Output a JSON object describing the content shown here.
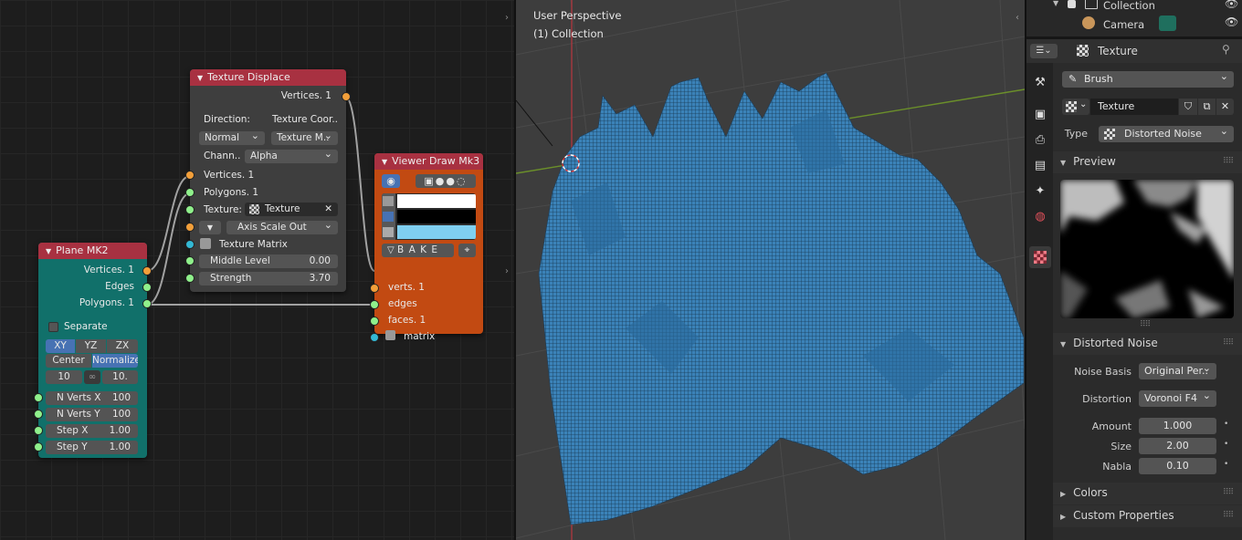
{
  "texture_displace": {
    "title": "Texture Displace",
    "out_vertices": "Vertices. 1",
    "direction_label": "Direction:",
    "direction_value": "Texture Coor..",
    "mode1": "Normal",
    "mode2": "Texture M..",
    "channel_label": "Chann..",
    "channel_value": "Alpha",
    "in_vertices": "Vertices. 1",
    "in_polygons": "Polygons. 1",
    "texture_label": "Texture:",
    "texture_value": "Texture",
    "axis_scale": "Axis Scale Out",
    "texture_matrix": "Texture Matrix",
    "middle_level_label": "Middle Level",
    "middle_level_value": "0.00",
    "strength_label": "Strength",
    "strength_value": "3.70"
  },
  "plane": {
    "title": "Plane MK2",
    "out_vertices": "Vertices. 1",
    "out_edges": "Edges",
    "out_polygons": "Polygons. 1",
    "separate_label": "Separate",
    "planes": [
      "XY",
      "YZ",
      "ZX"
    ],
    "center_label": "Center",
    "normalize_label": "Normalize",
    "size_a": "10",
    "size_b": "10.",
    "nverts_x_label": "N Verts X",
    "nverts_x_value": "100",
    "nverts_y_label": "N Verts Y",
    "nverts_y_value": "100",
    "step_x_label": "Step X",
    "step_x_value": "1.00",
    "step_y_label": "Step Y",
    "step_y_value": "1.00"
  },
  "viewer": {
    "title": "Viewer Draw Mk3",
    "bake_label": "B A K E",
    "in_verts": "verts. 1",
    "in_edges": "edges",
    "in_faces": "faces. 1",
    "in_matrix": "matrix",
    "colors": [
      "#ffffff",
      "#000000",
      "#7fcff0"
    ]
  },
  "viewport": {
    "perspective": "User Perspective",
    "collection": "(1) Collection",
    "mesh_color": "#3b82b8"
  },
  "outliner": {
    "collection_label": "Collection",
    "camera_label": "Camera"
  },
  "properties": {
    "header_title": "Texture",
    "brush_value": "Brush",
    "texture_name": "Texture",
    "type_label": "Type",
    "type_value": "Distorted Noise",
    "preview_heading": "Preview",
    "distorted_heading": "Distorted Noise",
    "noise_basis_label": "Noise Basis",
    "noise_basis_value": "Original Per..",
    "distortion_label": "Distortion",
    "distortion_value": "Voronoi F4",
    "amount_label": "Amount",
    "amount_value": "1.000",
    "size_label": "Size",
    "size_value": "2.00",
    "nabla_label": "Nabla",
    "nabla_value": "0.10",
    "colors_heading": "Colors",
    "custom_heading": "Custom Properties"
  }
}
